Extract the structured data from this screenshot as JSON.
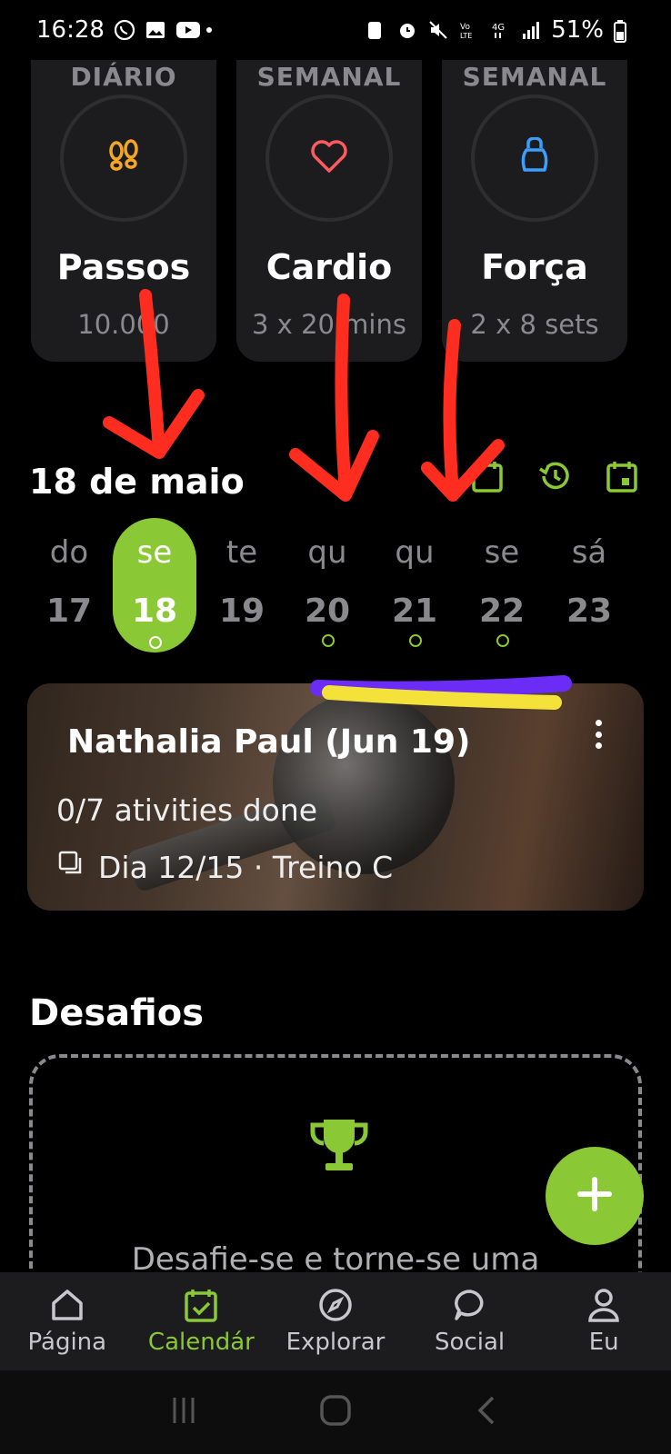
{
  "status_bar": {
    "time": "16:28",
    "battery": "51%"
  },
  "goals": [
    {
      "period": "DIÁRIO",
      "name": "Passos",
      "target": "10.000",
      "icon": "footsteps-icon",
      "color": "#f5a623"
    },
    {
      "period": "SEMANAL",
      "name": "Cardio",
      "target": "3 x 20 mins",
      "icon": "heart-icon",
      "color": "#ff5a5f"
    },
    {
      "period": "SEMANAL",
      "name": "Força",
      "target": "2 x 8 sets",
      "icon": "kettlebell-icon",
      "color": "#3aa0ff"
    }
  ],
  "date_section": {
    "title": "18 de maio",
    "actions": [
      "calendar-icon",
      "history-icon",
      "calendar-check-icon"
    ]
  },
  "week": [
    {
      "name": "do",
      "date": "17",
      "selected": false,
      "marked": false
    },
    {
      "name": "se",
      "date": "18",
      "selected": true,
      "marked": true
    },
    {
      "name": "te",
      "date": "19",
      "selected": false,
      "marked": false
    },
    {
      "name": "qu",
      "date": "20",
      "selected": false,
      "marked": true
    },
    {
      "name": "qu",
      "date": "21",
      "selected": false,
      "marked": true
    },
    {
      "name": "se",
      "date": "22",
      "selected": false,
      "marked": true
    },
    {
      "name": "sá",
      "date": "23",
      "selected": false,
      "marked": false
    }
  ],
  "program": {
    "title": "Nathalia Paul   (Jun 19)",
    "progress": "0/7 ativities done",
    "day_line": "Dia 12/15 · Treino C"
  },
  "challenges": {
    "title": "Desafios",
    "text": "Desafie-se e torne-se uma"
  },
  "nav": [
    {
      "label": "Página",
      "icon": "home-icon",
      "active": false
    },
    {
      "label": "Calendár",
      "icon": "calendar-check-icon",
      "active": true
    },
    {
      "label": "Explorar",
      "icon": "compass-icon",
      "active": false
    },
    {
      "label": "Social",
      "icon": "chat-bubble-icon",
      "active": false
    },
    {
      "label": "Eu",
      "icon": "profile-icon",
      "active": false
    }
  ],
  "colors": {
    "accent": "#8bc835",
    "card_bg": "#1c1c1e",
    "muted_text": "#8a8a8e",
    "annotation_red": "#ff2d1f"
  }
}
